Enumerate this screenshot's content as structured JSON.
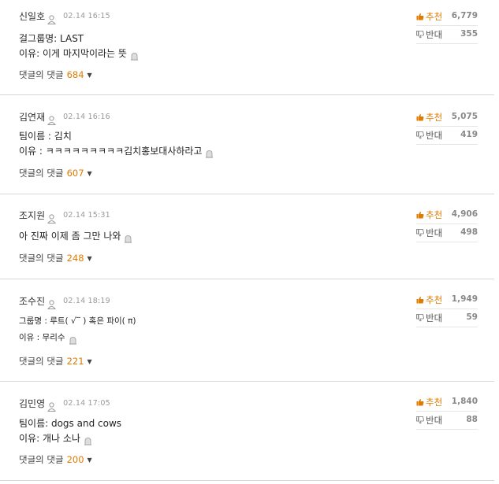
{
  "labels": {
    "reply_prefix": "댓글의 댓글",
    "up": "추천",
    "down": "반대"
  },
  "comments": [
    {
      "author": "신일호",
      "date": "02.14 16:15",
      "lines": [
        "걸그룹명: LAST",
        "이유: 이게 마지막이라는 뜻"
      ],
      "replies": "684",
      "up": "6,779",
      "down": "355"
    },
    {
      "author": "김연재",
      "date": "02.14 16:16",
      "lines": [
        "팀이름 : 김치",
        "이유 : ㅋㅋㅋㅋㅋㅋㅋㅋㅋ김치홍보대사하라고"
      ],
      "replies": "607",
      "up": "5,075",
      "down": "419"
    },
    {
      "author": "조지원",
      "date": "02.14 15:31",
      "lines": [
        "아 진짜 이제 좀 그만 나와"
      ],
      "replies": "248",
      "up": "4,906",
      "down": "498"
    },
    {
      "author": "조수진",
      "date": "02.14 18:19",
      "lines": [
        "그룹명 : 루트( √‾ ) 혹은 파이( π)",
        "이유 : 무리수"
      ],
      "replies": "221",
      "up": "1,949",
      "down": "59"
    },
    {
      "author": "김민영",
      "date": "02.14 17:05",
      "lines": [
        "팀이름: dogs and cows",
        "이유: 개나 소나"
      ],
      "replies": "200",
      "up": "1,840",
      "down": "88"
    }
  ]
}
